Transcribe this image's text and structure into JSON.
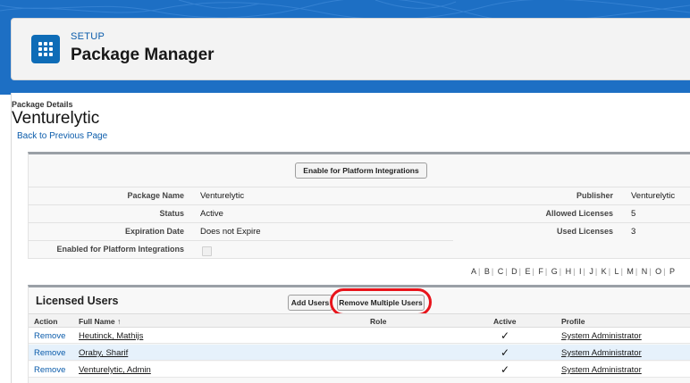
{
  "header": {
    "setup_label": "SETUP",
    "title": "Package Manager",
    "app_icon": "app-launcher-grid-icon"
  },
  "page": {
    "details_label": "Package Details",
    "package_title": "Venturelytic",
    "back_link": "Back to Previous Page"
  },
  "details": {
    "enable_button": "Enable for Platform Integrations",
    "fields_left": [
      {
        "label": "Package Name",
        "value": "Venturelytic"
      },
      {
        "label": "Status",
        "value": "Active"
      },
      {
        "label": "Expiration Date",
        "value": "Does not Expire"
      },
      {
        "label": "Enabled for Platform Integrations",
        "value": ""
      }
    ],
    "fields_right": [
      {
        "label": "Publisher",
        "value": "Venturelytic"
      },
      {
        "label": "Allowed Licenses",
        "value": "5"
      },
      {
        "label": "Used Licenses",
        "value": "3"
      }
    ]
  },
  "alphabet": [
    "A",
    "B",
    "C",
    "D",
    "E",
    "F",
    "G",
    "H",
    "I",
    "J",
    "K",
    "L",
    "M",
    "N",
    "O",
    "P"
  ],
  "licensed_users": {
    "title": "Licensed Users",
    "add_button": "Add Users",
    "remove_multiple_button": "Remove Multiple Users",
    "columns": [
      "Action",
      "Full Name ↑",
      "Role",
      "Active",
      "Profile"
    ],
    "rows": [
      {
        "action": "Remove",
        "name": "Heutinck, Mathijs",
        "role": "",
        "active": "✓",
        "profile": "System Administrator"
      },
      {
        "action": "Remove",
        "name": "Oraby, Sharif",
        "role": "",
        "active": "✓",
        "profile": "System Administrator"
      },
      {
        "action": "Remove",
        "name": "Venturelytic, Admin",
        "role": "",
        "active": "✓",
        "profile": "System Administrator"
      }
    ]
  },
  "colors": {
    "brand_blue": "#1d6fc4",
    "link_blue": "#0b5cab",
    "highlight_red": "#e8141b",
    "selected_row": "#e6f1fb"
  }
}
